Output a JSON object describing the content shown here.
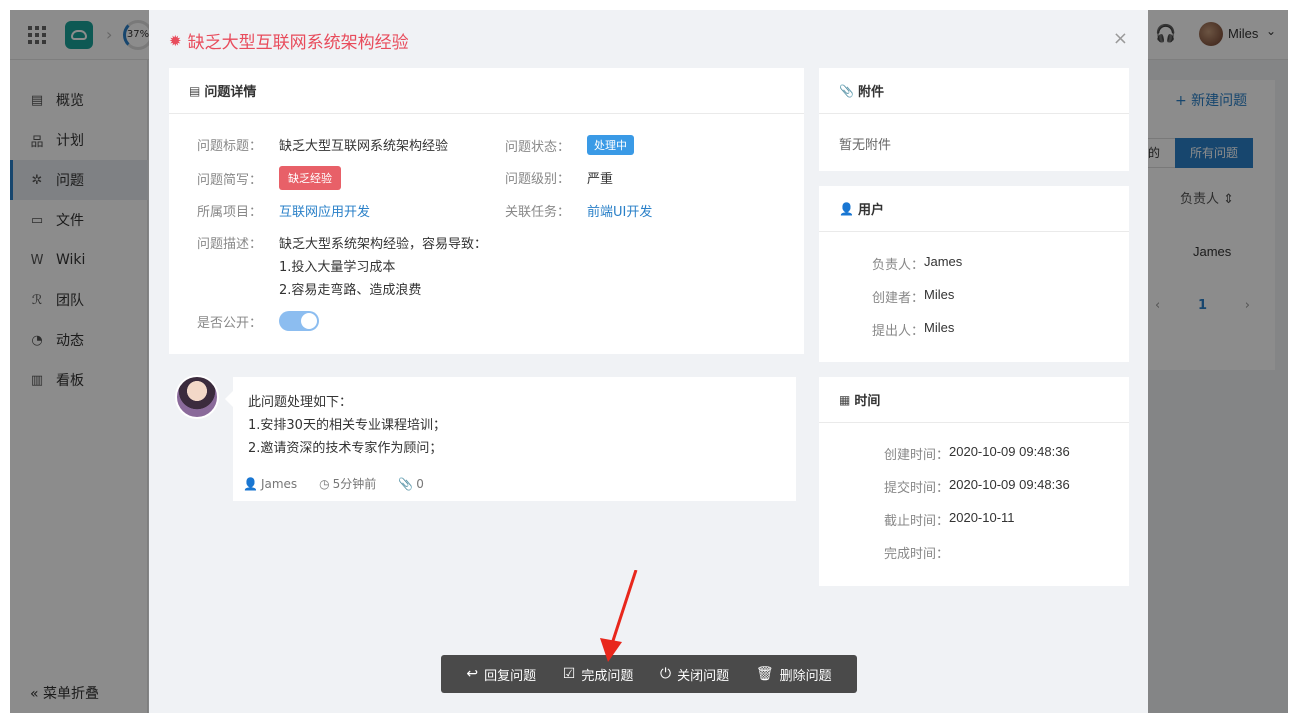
{
  "app": {
    "progress_label": "37%",
    "user_name": "Miles",
    "sidebar": [
      {
        "label": "概览",
        "icon": "overview-icon",
        "glyph": "▤"
      },
      {
        "label": "计划",
        "icon": "plan-icon",
        "glyph": "品"
      },
      {
        "label": "问题",
        "icon": "bug-icon",
        "glyph": "✲"
      },
      {
        "label": "文件",
        "icon": "folder-icon",
        "glyph": "▭"
      },
      {
        "label": "Wiki",
        "icon": "wiki-icon",
        "glyph": "W"
      },
      {
        "label": "团队",
        "icon": "team-icon",
        "glyph": "ℛ"
      },
      {
        "label": "动态",
        "icon": "activity-icon",
        "glyph": "◔"
      },
      {
        "label": "看板",
        "icon": "board-icon",
        "glyph": "▥"
      }
    ],
    "collapse_label": "菜单折叠",
    "bg_new_issue": "+ 新建问题",
    "bg_tab_left": "的",
    "bg_tab_all": "所有问题",
    "bg_column": "负责人 ⇕",
    "bg_cell": "James",
    "bg_pager": {
      "prev": "‹",
      "page": "1",
      "next": "›"
    }
  },
  "modal": {
    "title": "缺乏大型互联网系统架构经验",
    "close": "×",
    "detail": {
      "header": "问题详情",
      "fields": {
        "title_label": "问题标题：",
        "title_value": "缺乏大型互联网系统架构经验",
        "status_label": "问题状态：",
        "status_value": "处理中",
        "brief_label": "问题简写：",
        "brief_value": "缺乏经验",
        "level_label": "问题级别：",
        "level_value": "严重",
        "project_label": "所属项目：",
        "project_value": "互联网应用开发",
        "task_label": "关联任务：",
        "task_value": "前端UI开发",
        "desc_label": "问题描述：",
        "desc_lines": [
          "缺乏大型系统架构经验，容易导致：",
          "1.投入大量学习成本",
          "2.容易走弯路、造成浪费"
        ],
        "public_label": "是否公开："
      },
      "public_on": true
    },
    "attachments": {
      "header": "附件",
      "empty": "暂无附件"
    },
    "users": {
      "header": "用户",
      "rows": [
        {
          "k": "负责人：",
          "v": "James"
        },
        {
          "k": "创建者：",
          "v": "Miles"
        },
        {
          "k": "提出人：",
          "v": "Miles"
        }
      ]
    },
    "times": {
      "header": "时间",
      "rows": [
        {
          "k": "创建时间：",
          "v": "2020-10-09 09:48:36"
        },
        {
          "k": "提交时间：",
          "v": "2020-10-09 09:48:36"
        },
        {
          "k": "截止时间：",
          "v": "2020-10-11"
        },
        {
          "k": "完成时间：",
          "v": ""
        }
      ]
    },
    "comment": {
      "lines": [
        "此问题处理如下：",
        "1.安排30天的相关专业课程培训；",
        "2.邀请资深的技术专家作为顾问；"
      ],
      "author": "James",
      "time": "5分钟前",
      "attachments": "0"
    },
    "actions": [
      {
        "label": "回复问题",
        "icon": "reply-icon",
        "glyph": "↩"
      },
      {
        "label": "完成问题",
        "icon": "check-square-icon",
        "glyph": "☑"
      },
      {
        "label": "关闭问题",
        "icon": "power-icon",
        "glyph": "⏻"
      },
      {
        "label": "删除问题",
        "icon": "trash-icon",
        "glyph": "🗑"
      }
    ]
  },
  "colors": {
    "accent": "#2a80c8",
    "title_red": "#e84c5c",
    "badge_blue": "#3a9ae6",
    "badge_red": "#e86068",
    "arrow_red": "#e8271c"
  }
}
